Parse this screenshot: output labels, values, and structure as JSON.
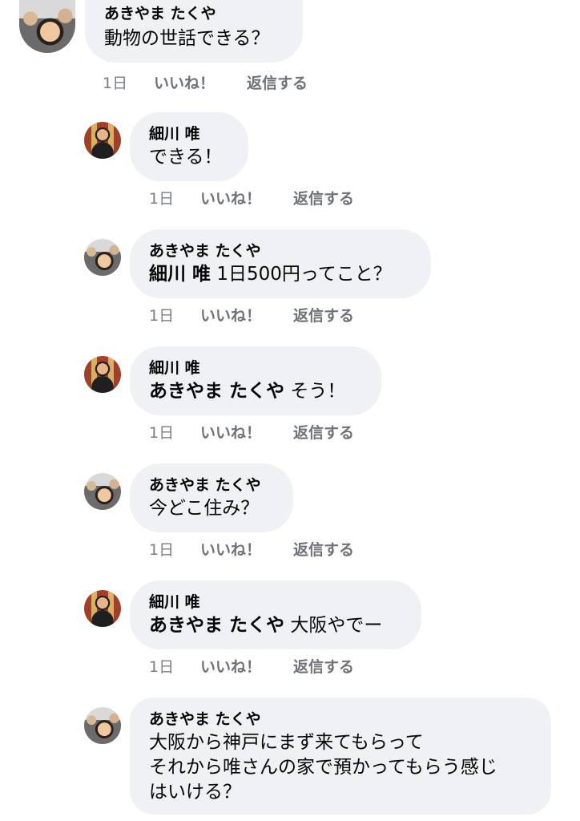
{
  "comments": [
    {
      "author": "あきやま たくや",
      "mention": "",
      "text": "動物の世話できる？",
      "time": "1日",
      "like": "いいね！",
      "reply": "返信する"
    },
    {
      "author": "細川 唯",
      "mention": "",
      "text": "できる！",
      "time": "1日",
      "like": "いいね！",
      "reply": "返信する"
    },
    {
      "author": "あきやま たくや",
      "mention": "細川 唯",
      "text": " 1日500円ってこと？",
      "time": "1日",
      "like": "いいね！",
      "reply": "返信する"
    },
    {
      "author": "細川 唯",
      "mention": "あきやま たくや",
      "text": " そう！",
      "time": "1日",
      "like": "いいね！",
      "reply": "返信する"
    },
    {
      "author": "あきやま たくや",
      "mention": "",
      "text": "今どこ住み？",
      "time": "1日",
      "like": "いいね！",
      "reply": "返信する"
    },
    {
      "author": "細川 唯",
      "mention": "あきやま たくや",
      "text": " 大阪やでー",
      "time": "1日",
      "like": "いいね！",
      "reply": "返信する"
    },
    {
      "author": "あきやま たくや",
      "mention": "",
      "lines": [
        "大阪から神戸にまず来てもらって",
        "それから唯さんの家で預かってもらう感じ",
        "はいける？"
      ]
    }
  ]
}
